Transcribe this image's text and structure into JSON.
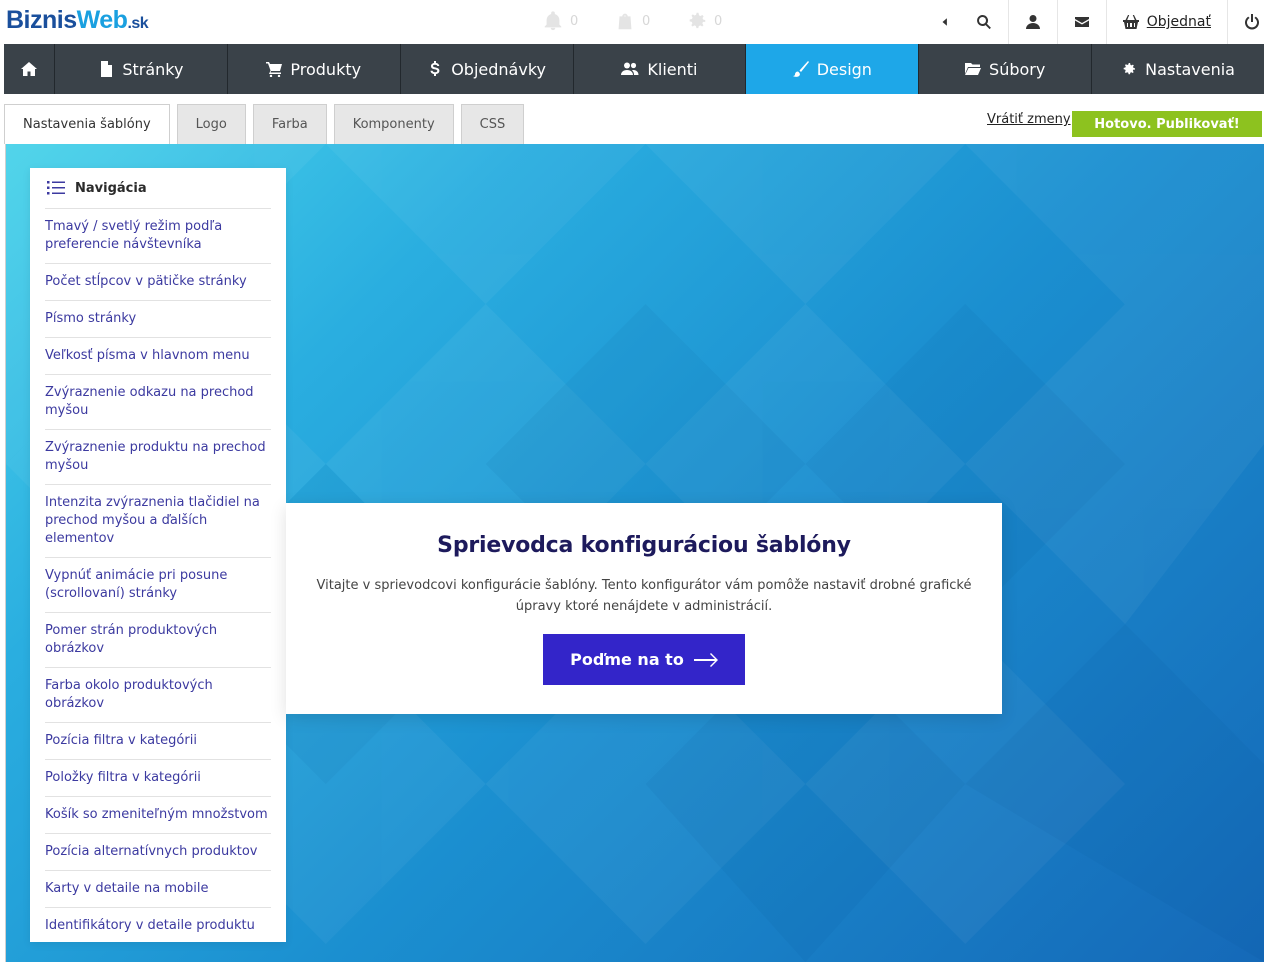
{
  "brand": {
    "part1": "Biznis",
    "part2": "Web",
    "part3": ".sk"
  },
  "notifications": [
    {
      "icon": "bell-icon",
      "count": "0"
    },
    {
      "icon": "bag-icon",
      "count": "0"
    },
    {
      "icon": "gear-icon",
      "count": "0"
    }
  ],
  "toolbar": {
    "order_label": "Objednať"
  },
  "mainnav": {
    "items": [
      {
        "label": "Stránky",
        "icon": "page-icon"
      },
      {
        "label": "Produkty",
        "icon": "cart-icon"
      },
      {
        "label": "Objednávky",
        "icon": "dollar-icon"
      },
      {
        "label": "Klienti",
        "icon": "users-icon"
      },
      {
        "label": "Design",
        "icon": "brush-icon"
      },
      {
        "label": "Súbory",
        "icon": "folder-icon"
      },
      {
        "label": "Nastavenia",
        "icon": "cog-icon"
      }
    ]
  },
  "subtabs": [
    "Nastavenia šablóny",
    "Logo",
    "Farba",
    "Komponenty",
    "CSS"
  ],
  "actions": {
    "revert": "Vrátiť zmeny",
    "publish": "Hotovo. Publikovať!"
  },
  "navigation": {
    "title": "Navigácia",
    "items": [
      "Tmavý / svetlý režim podľa preferencie návštevníka",
      "Počet stĺpcov v pätičke stránky",
      "Písmo stránky",
      "Veľkosť písma v hlavnom menu",
      "Zvýraznenie odkazu na prechod myšou",
      "Zvýraznenie produktu na prechod myšou",
      "Intenzita zvýraznenia tlačidiel na prechod myšou a ďalších elementov",
      "Vypnúť animácie pri posune (scrollovaní) stránky",
      "Pomer strán produktových obrázkov",
      "Farba okolo produktových obrázkov",
      "Pozícia filtra v kategórii",
      "Položky filtra v kategórii",
      "Košík so zmeniteľným množstvom",
      "Pozícia alternatívnych produktov",
      "Karty v detaile na mobile",
      "Identifikátory v detaile produktu"
    ]
  },
  "wizard": {
    "title": "Sprievodca konfiguráciou šablóny",
    "text": "Vitajte v sprievodcovi konfigurácie šablóny. Tento konfigurátor vám pomôže nastaviť drobné grafické úpravy ktoré nenájdete v administrácií.",
    "button": "Poďme na to"
  },
  "colors": {
    "accent": "#1ea7e8",
    "nav_bg": "#3a4249",
    "publish": "#8dc21f",
    "cta": "#3325c9",
    "link": "#3c3aa0"
  }
}
